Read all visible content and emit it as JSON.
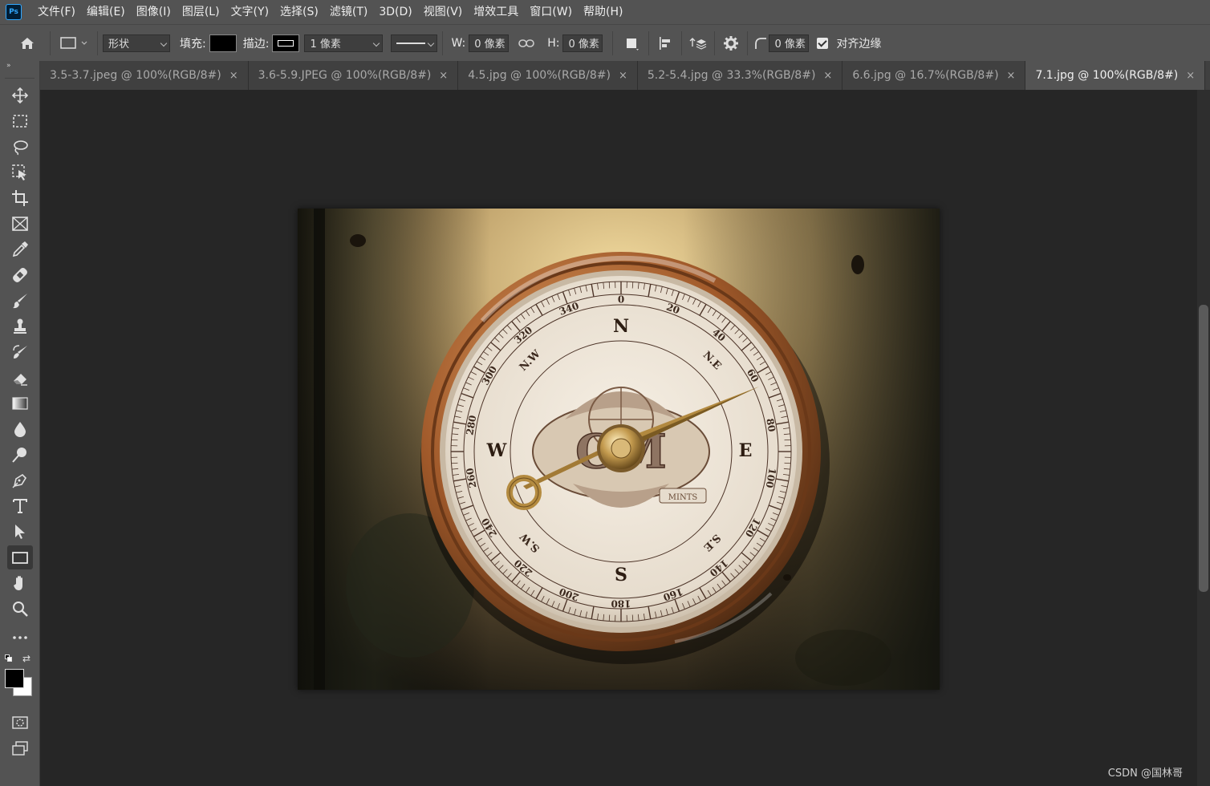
{
  "app": {
    "logo": "Ps"
  },
  "menu": [
    "文件(F)",
    "编辑(E)",
    "图像(I)",
    "图层(L)",
    "文字(Y)",
    "选择(S)",
    "滤镜(T)",
    "3D(D)",
    "视图(V)",
    "增效工具",
    "窗口(W)",
    "帮助(H)"
  ],
  "options": {
    "mode": "形状",
    "fill_label": "填充:",
    "stroke_label": "描边:",
    "stroke_width": "1 像素",
    "w_label": "W:",
    "w_value": "0 像素",
    "h_label": "H:",
    "h_value": "0 像素",
    "radius_value": "0 像素",
    "align_edges_label": "对齐边缘",
    "fill_color": "#000000"
  },
  "toolbox": {
    "expand": "»"
  },
  "tabs": [
    {
      "label": "3.5-3.7.jpeg @ 100%(RGB/8#)",
      "close": "×"
    },
    {
      "label": "3.6-5.9.JPEG @ 100%(RGB/8#)",
      "close": "×"
    },
    {
      "label": "4.5.jpg @ 100%(RGB/8#)",
      "close": "×"
    },
    {
      "label": "5.2-5.4.jpg @ 33.3%(RGB/8#)",
      "close": "×"
    },
    {
      "label": "6.6.jpg @ 16.7%(RGB/8#)",
      "close": "×"
    },
    {
      "label": "7.1.jpg @ 100%(RGB/8#)",
      "close": "×"
    }
  ],
  "compass": {
    "cardinals": [
      "N",
      "E",
      "S",
      "W"
    ],
    "intercardinals": [
      "N.E",
      "S.E",
      "S.W",
      "N.W"
    ],
    "degrees": [
      "0",
      "20",
      "40",
      "60",
      "80",
      "100",
      "120",
      "140",
      "160",
      "180",
      "200",
      "220",
      "240",
      "260",
      "280",
      "300",
      "320",
      "340"
    ],
    "emblem": "GM",
    "ribbon": "MINTS"
  },
  "watermark": "CSDN @国林哥"
}
